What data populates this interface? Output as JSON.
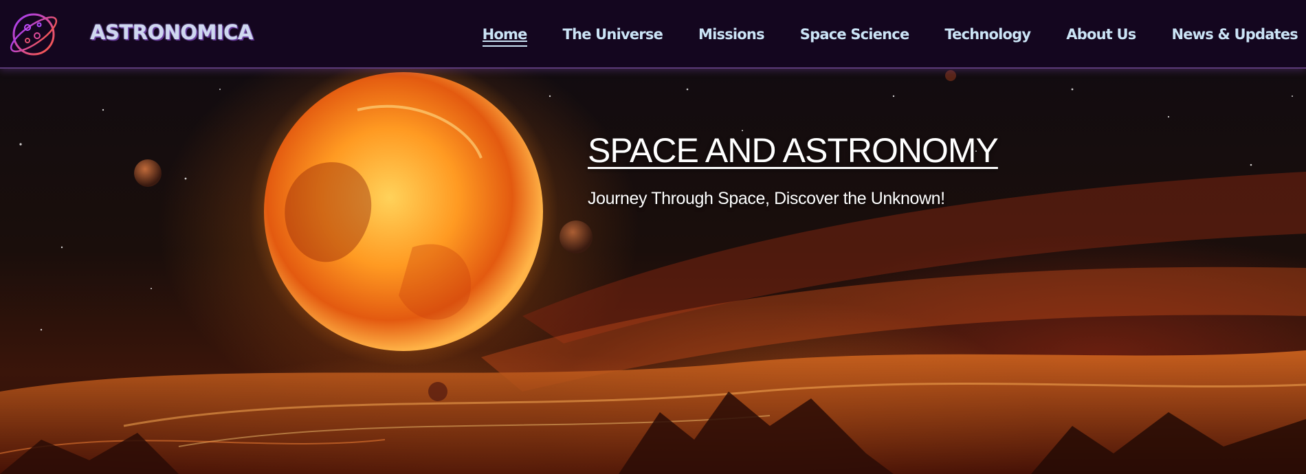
{
  "header": {
    "brand": "ASTRONOMICA",
    "logo_icon": "planet-orbit-icon",
    "nav": [
      {
        "label": "Home",
        "active": true
      },
      {
        "label": "The Universe",
        "active": false
      },
      {
        "label": "Missions",
        "active": false
      },
      {
        "label": "Space Science",
        "active": false
      },
      {
        "label": "Technology",
        "active": false
      },
      {
        "label": "About Us",
        "active": false
      },
      {
        "label": "News & Updates",
        "active": false
      }
    ]
  },
  "hero": {
    "title": "SPACE AND ASTRONOMY",
    "subtitle": "Journey Through Space, Discover the Unknown!",
    "image": "fiery-planet-space-scene"
  },
  "colors": {
    "header_bg": "#14061f",
    "nav_text": "#cbe4f6",
    "logo_gradient_start": "#a23cff",
    "logo_gradient_end": "#ff5a3c",
    "hero_text": "#ffffff"
  }
}
